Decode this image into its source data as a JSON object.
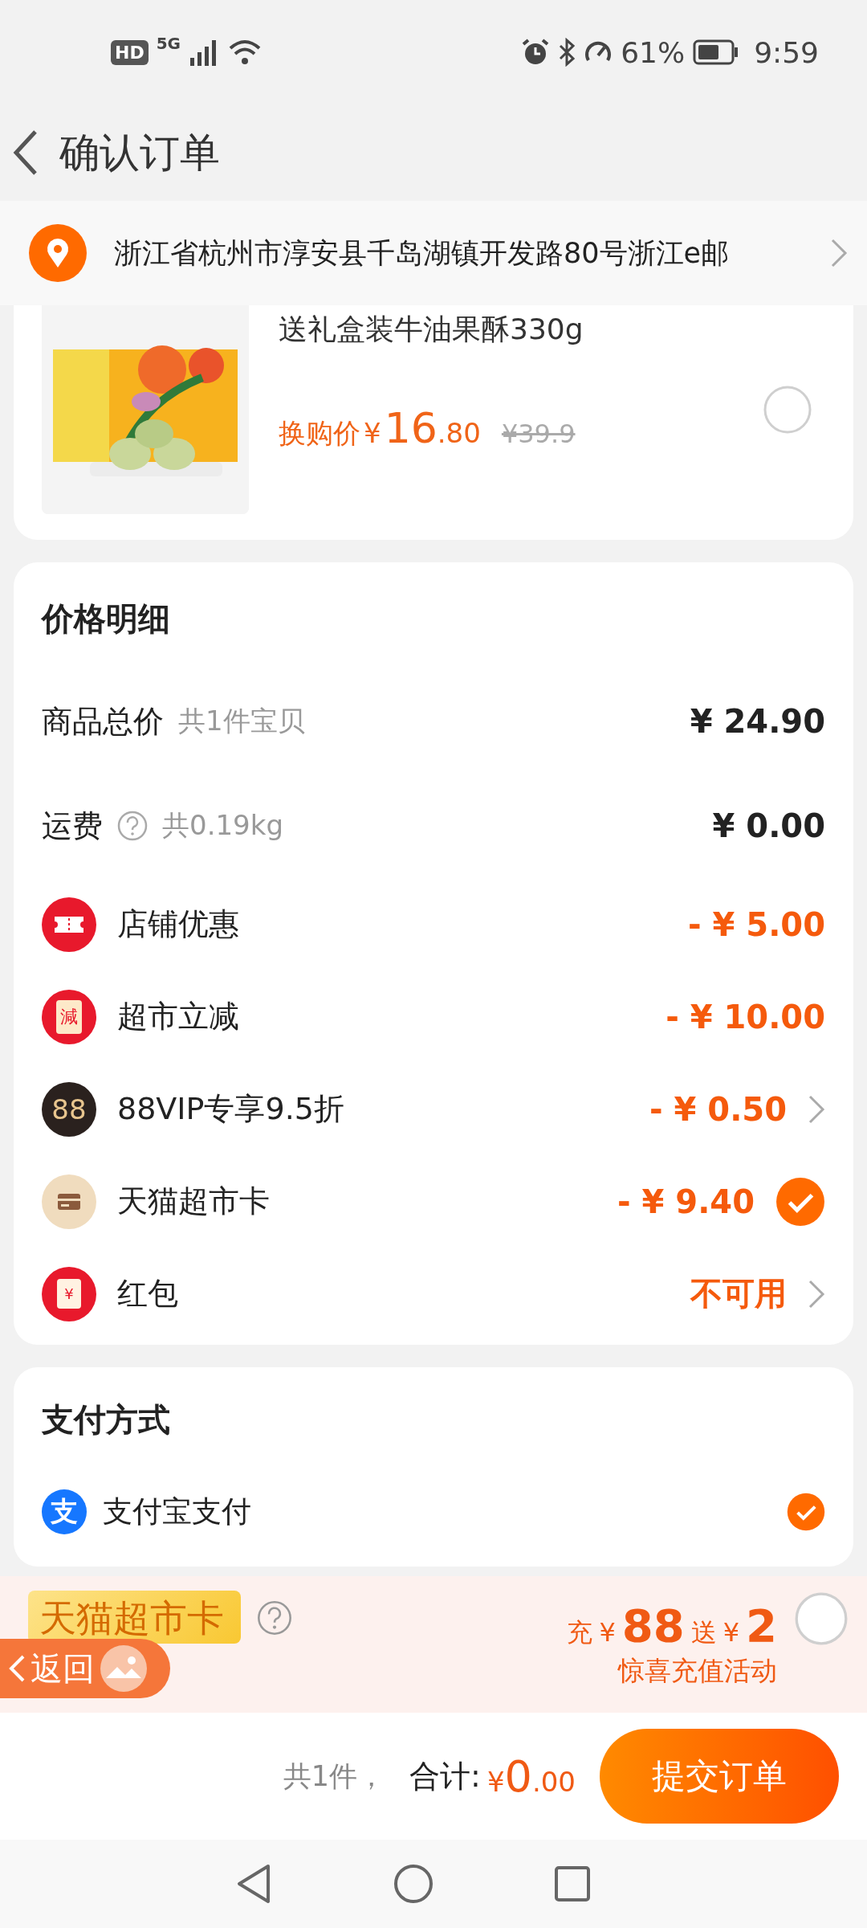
{
  "status_bar": {
    "hd": "HD",
    "network": "5G",
    "battery": "61%",
    "time": "9:59"
  },
  "header": {
    "title": "确认订单"
  },
  "address": {
    "text": "浙江省杭州市淳安县千岛湖镇开发路80号浙江e邮"
  },
  "product": {
    "kind": "picture",
    "title": "送礼盒装牛油果酥330g",
    "price_label": "换购价",
    "currency": "¥",
    "price_int": "16",
    "price_dec": ".80",
    "original_price": "¥39.9",
    "selected": false
  },
  "price_detail": {
    "title": "价格明细",
    "rows": [
      {
        "kind": "plain",
        "label": "商品总价",
        "note": "共1件宝贝",
        "amount": "¥ 24.90"
      },
      {
        "kind": "help",
        "label": "运费",
        "note": "共0.19kg",
        "amount": "¥ 0.00"
      },
      {
        "kind": "coupon",
        "label": "店铺优惠",
        "amount": "- ¥ 5.00"
      },
      {
        "kind": "instant",
        "icon_text": "減",
        "label": "超市立减",
        "amount": "- ¥ 10.00"
      },
      {
        "kind": "vip",
        "icon_text": "88",
        "label": "88VIP专享9.5折",
        "amount": "- ¥ 0.50",
        "chevron": true
      },
      {
        "kind": "card",
        "label": "天猫超市卡",
        "amount": "- ¥ 9.40",
        "checked": true
      },
      {
        "kind": "redpacket",
        "icon_text": "¥",
        "label": "红包",
        "amount": "不可用",
        "chevron": true
      }
    ]
  },
  "payment": {
    "title": "支付方式",
    "methods": [
      {
        "icon_text": "支",
        "name": "支付宝支付",
        "selected": true
      }
    ]
  },
  "promo": {
    "card_label": "天猫超市卡",
    "recharge": "充",
    "recharge_currency": "¥",
    "recharge_amount": "88",
    "bonus": "送",
    "bonus_currency": "¥",
    "bonus_amount": "2",
    "subtitle": "惊喜充值活动",
    "selected": false
  },
  "float_back": {
    "label": "返回"
  },
  "bottom_bar": {
    "count": "共1件，",
    "total_label": "合计:",
    "currency": "¥",
    "total_int": "0",
    "total_dec": ".00",
    "submit": "提交订单"
  }
}
